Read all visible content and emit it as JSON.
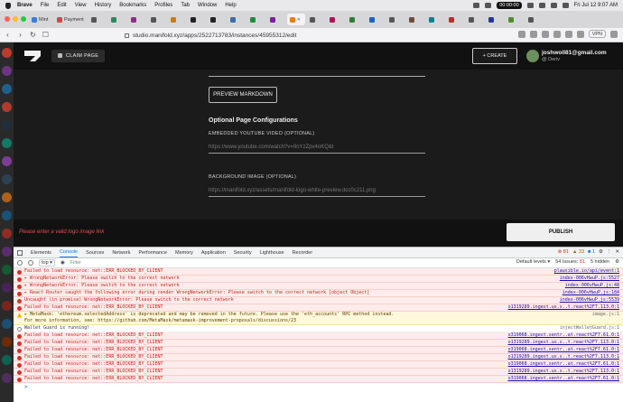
{
  "menubar": {
    "app": "Brave",
    "items": [
      "File",
      "Edit",
      "View",
      "History",
      "Bookmarks",
      "Profiles",
      "Tab",
      "Window",
      "Help"
    ],
    "record_time": "00:00:00",
    "datetime": "Fri Jul 12  9:07 AM"
  },
  "tabs": [
    {
      "label": "Mint",
      "active": false
    },
    {
      "label": "Payment",
      "active": false
    },
    {
      "label": "",
      "active": false
    },
    {
      "label": "",
      "active": false
    },
    {
      "label": "",
      "active": false
    },
    {
      "label": "",
      "active": false
    },
    {
      "label": "",
      "active": false
    },
    {
      "label": "",
      "active": false
    },
    {
      "label": "",
      "active": false
    },
    {
      "label": "",
      "active": false
    },
    {
      "label": "",
      "active": false
    },
    {
      "label": "",
      "active": false
    },
    {
      "label": "",
      "active": true
    },
    {
      "label": "",
      "active": false
    },
    {
      "label": "",
      "active": false
    },
    {
      "label": "",
      "active": false
    },
    {
      "label": "",
      "active": false
    },
    {
      "label": "",
      "active": false
    },
    {
      "label": "",
      "active": false
    },
    {
      "label": "",
      "active": false
    },
    {
      "label": "",
      "active": false
    },
    {
      "label": "",
      "active": false
    },
    {
      "label": "",
      "active": false
    },
    {
      "label": "",
      "active": false
    },
    {
      "label": "",
      "active": false
    }
  ],
  "address": {
    "url": "studio.manifold.xyz/apps/2522713783/instances/45955312/edit",
    "vpn": "VPN"
  },
  "page": {
    "claim_label": "CLAIM PAGE",
    "create_label": "+ CREATE",
    "user_name": "joshwoll81@gmail.com",
    "user_sub": "@ Deriv",
    "preview_label": "PREVIEW MARKDOWN",
    "section_heading": "Optional Page Configurations",
    "youtube_label": "EMBEDDED YOUTUBE VIDEO (OPTIONAL)",
    "youtube_placeholder": "https://www.youtube.com/watch?v=9nYzZpv4oKQ&t",
    "bg_label": "BACKGROUND IMAGE (OPTIONAL)",
    "bg_placeholder": "https://manifold.xyz/assets/manifold-logo-white-preview.dcc0c211.png",
    "error": "Please enter a valid logo image link",
    "publish_label": "PUBLISH"
  },
  "devtools": {
    "tabs": [
      "Elements",
      "Console",
      "Sources",
      "Network",
      "Performance",
      "Memory",
      "Application",
      "Security",
      "Lighthouse",
      "Recorder"
    ],
    "active_tab": "Console",
    "errors": "81",
    "warnings": "33",
    "infos": "1",
    "context": "top",
    "filter_placeholder": "Filter",
    "levels": "Default levels ▾",
    "issues": "54 Issues: ",
    "hidden": "5 hidden",
    "logs": [
      {
        "level": "err",
        "text": "Failed to load resource: net::ERR_BLOCKED_BY_CLIENT",
        "src": "plausible.io/api/event:1"
      },
      {
        "level": "err",
        "text": "▸ WrongNetworkError: Please switch to the correct network",
        "src": "index-006vHwuP.js:5527"
      },
      {
        "level": "err",
        "text": "▸ WrongNetworkError: Please switch to the correct network",
        "src": "index-006vHwuP.js:48"
      },
      {
        "level": "err",
        "text": "▸ React Router caught the following error during render WrongNetworkError: Please switch to the correct network [object Object]",
        "src": "index-006vHwuP.js:184"
      },
      {
        "level": "err",
        "text": "Uncaught (in promise) WrongNetworkError: Please switch to the correct network",
        "src": "index-006vHwuP.js:5539"
      },
      {
        "level": "err",
        "text": "Failed to load resource: net::ERR_BLOCKED_BY_CLIENT",
        "src": "o1319289.ingest.us.s..t.react%2F7.113.0:1"
      },
      {
        "level": "warn",
        "text": "▸ MetaMask: 'ethereum.selectedAddress' is deprecated and may be removed in the future. Please use the 'eth_accounts' RPC method instead.",
        "sub": "For more information, see: https://github.com/MetaMask/metamask-improvement-proposals/discussions/23",
        "src": "image.js:1"
      },
      {
        "level": "info",
        "text": "Wallet Guard is running!",
        "src": "injectWalletGuard.js:1"
      },
      {
        "level": "err",
        "text": "Failed to load resource: net::ERR_BLOCKED_BY_CLIENT",
        "src": "o319068.ingest.sentr..at.react%2F7.61.0:1"
      },
      {
        "level": "err",
        "text": "Failed to load resource: net::ERR_BLOCKED_BY_CLIENT",
        "src": "o1319289.ingest.us.s..t.react%2F7.113.0:1"
      },
      {
        "level": "err",
        "text": "Failed to load resource: net::ERR_BLOCKED_BY_CLIENT",
        "src": "o319068.ingest.sentr..at.react%2F7.61.0:1"
      },
      {
        "level": "err",
        "text": "Failed to load resource: net::ERR_BLOCKED_BY_CLIENT",
        "src": "o1319289.ingest.us.s..t.react%2F7.113.0:1"
      },
      {
        "level": "err",
        "text": "Failed to load resource: net::ERR_BLOCKED_BY_CLIENT",
        "src": "o319068.ingest.sentr..at.react%2F7.61.0:1"
      },
      {
        "level": "err",
        "text": "Failed to load resource: net::ERR_BLOCKED_BY_CLIENT",
        "src": "o1319289.ingest.us.s..t.react%2F7.113.0:1"
      },
      {
        "level": "err",
        "text": "Failed to load resource: net::ERR_BLOCKED_BY_CLIENT",
        "src": "o319068.ingest.sentr..at.react%2F7.61.0:1"
      }
    ],
    "prompt": ">"
  },
  "colors": {
    "page_bg": "#1b1b1b",
    "nav_bg": "#111111",
    "error_red": "#e05050",
    "publish_bg": "#efefef"
  }
}
